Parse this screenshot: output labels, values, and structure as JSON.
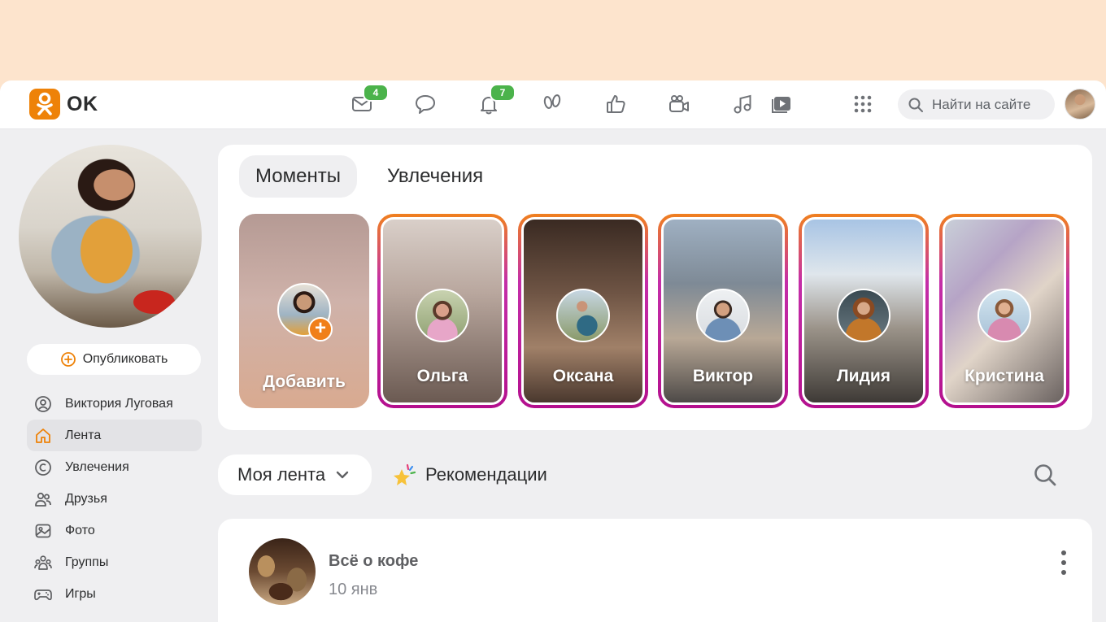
{
  "header": {
    "logo_text": "OK",
    "messages_badge": "4",
    "notifications_badge": "7",
    "search_placeholder": "Найти на сайте",
    "nav_icons": [
      "mail-icon",
      "discussions-icon",
      "bell-icon",
      "guests-icon",
      "likes-icon",
      "video-icon",
      "music-icon",
      "video-showcase-icon",
      "apps-grid-icon"
    ]
  },
  "sidebar": {
    "publish_label": "Опубликовать",
    "items": [
      {
        "label": "Виктория Луговая",
        "icon": "profile-icon"
      },
      {
        "label": "Лента",
        "icon": "home-icon",
        "active": true
      },
      {
        "label": "Увлечения",
        "icon": "hobbies-icon"
      },
      {
        "label": "Друзья",
        "icon": "friends-icon"
      },
      {
        "label": "Фото",
        "icon": "photo-icon"
      },
      {
        "label": "Группы",
        "icon": "groups-icon"
      },
      {
        "label": "Игры",
        "icon": "games-icon"
      }
    ]
  },
  "moments": {
    "tabs": [
      {
        "label": "Моменты",
        "active": true
      },
      {
        "label": "Увлечения",
        "active": false
      }
    ],
    "stories": [
      {
        "name": "Добавить"
      },
      {
        "name": "Ольга"
      },
      {
        "name": "Оксана"
      },
      {
        "name": "Виктор"
      },
      {
        "name": "Лидия"
      },
      {
        "name": "Кристина"
      }
    ]
  },
  "feed": {
    "select_label": "Моя лента",
    "recommendations_label": "Рекомендации"
  },
  "post": {
    "title": "Всё о кофе",
    "date": "10 янв"
  },
  "colors": {
    "brand_orange": "#ee8208",
    "badge_green": "#4bb34b",
    "page_peach": "#fde4cd",
    "app_bg": "#efeff1"
  }
}
